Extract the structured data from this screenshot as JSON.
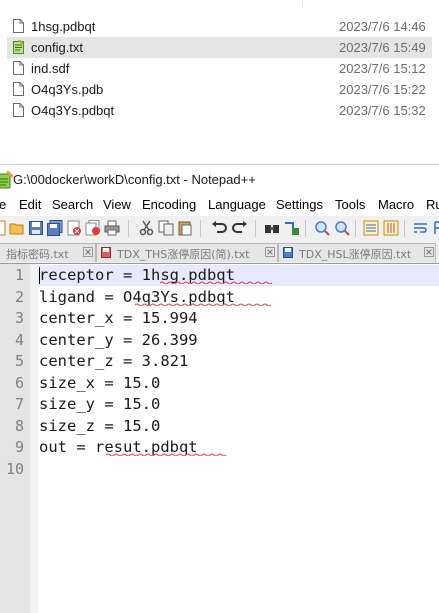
{
  "explorer": {
    "files": [
      {
        "name": "1hsg.pdbqt",
        "date": "2023/7/6 14:46",
        "icon": "file-icon",
        "selected": false
      },
      {
        "name": "config.txt",
        "date": "2023/7/6 15:49",
        "icon": "notepadpp-file-icon",
        "selected": true
      },
      {
        "name": "ind.sdf",
        "date": "2023/7/6 15:12",
        "icon": "file-icon",
        "selected": false
      },
      {
        "name": "O4q3Ys.pdb",
        "date": "2023/7/6 15:22",
        "icon": "file-icon",
        "selected": false
      },
      {
        "name": "O4q3Ys.pdbqt",
        "date": "2023/7/6 15:32",
        "icon": "file-icon",
        "selected": false
      }
    ]
  },
  "window": {
    "title": "G:\\00docker\\workD\\config.txt - Notepad++"
  },
  "menu": [
    "e",
    "Edit",
    "Search",
    "View",
    "Encoding",
    "Language",
    "Settings",
    "Tools",
    "Macro",
    "Ru"
  ],
  "tabs": [
    {
      "label": "指标密码.txt",
      "state": "unsaved"
    },
    {
      "label": "TDX_THS涨停原因(简).txt",
      "state": "unsaved"
    },
    {
      "label": "TDX_HSL涨停原因.txt",
      "state": "saved"
    }
  ],
  "editor": {
    "lines": [
      "receptor = 1hsg.pdbqt",
      "ligand = O4q3Ys.pdbqt",
      "center_x = 15.994",
      "center_y = 26.399",
      "center_z = 3.821",
      "size_x = 15.0",
      "size_y = 15.0",
      "size_z = 15.0",
      "out = resut.pdbqt",
      ""
    ],
    "line_numbers": [
      "1",
      "2",
      "3",
      "4",
      "5",
      "6",
      "7",
      "8",
      "9",
      "10"
    ],
    "current_line": 1
  },
  "colors": {
    "selection": "#e5e5e5",
    "current_line": "#e8e8ff",
    "gutter": "#e4e4e4",
    "spellcheck": "#e03c3c"
  }
}
